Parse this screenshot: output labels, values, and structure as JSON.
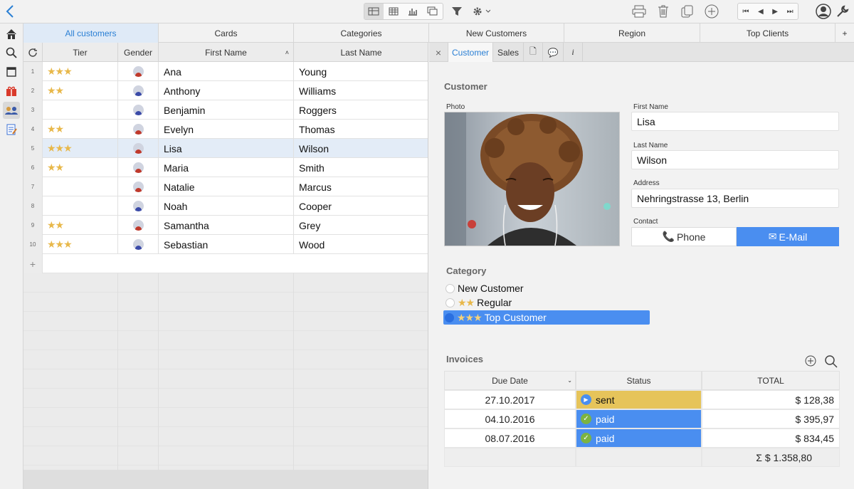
{
  "toolbar": {
    "back": "back",
    "views": [
      "form-view",
      "grid-view",
      "chart-view",
      "gallery-view"
    ],
    "filter": "filter",
    "settings": "settings",
    "actions": [
      "print",
      "delete",
      "duplicate",
      "add"
    ],
    "nav": [
      "first",
      "previous",
      "next",
      "last"
    ],
    "account": "account",
    "tools": "tools"
  },
  "sidebar": [
    {
      "name": "home-icon"
    },
    {
      "name": "search-icon"
    },
    {
      "name": "window-icon"
    },
    {
      "name": "gift-icon"
    },
    {
      "name": "customers-icon",
      "selected": true
    },
    {
      "name": "notes-icon"
    }
  ],
  "tabs": [
    "All customers",
    "Cards",
    "Categories",
    "New Customers",
    "Region",
    "Top Clients"
  ],
  "tabs_add": "+",
  "grid": {
    "headers": [
      "Tier",
      "Gender",
      "First Name",
      "Last Name"
    ],
    "sort_indicator": "˄",
    "rows": [
      {
        "n": "1",
        "stars": "★★★",
        "gender": "f",
        "first": "Ana",
        "last": "Young"
      },
      {
        "n": "2",
        "stars": "★★",
        "gender": "m",
        "first": "Anthony",
        "last": "Williams"
      },
      {
        "n": "3",
        "stars": "",
        "gender": "m",
        "first": "Benjamin",
        "last": "Roggers"
      },
      {
        "n": "4",
        "stars": "★★",
        "gender": "f",
        "first": "Evelyn",
        "last": "Thomas"
      },
      {
        "n": "5",
        "stars": "★★★",
        "gender": "f",
        "first": "Lisa",
        "last": "Wilson",
        "selected": true
      },
      {
        "n": "6",
        "stars": "★★",
        "gender": "f",
        "first": "Maria",
        "last": "Smith"
      },
      {
        "n": "7",
        "stars": "",
        "gender": "f",
        "first": "Natalie",
        "last": "Marcus"
      },
      {
        "n": "8",
        "stars": "",
        "gender": "m",
        "first": "Noah",
        "last": "Cooper"
      },
      {
        "n": "9",
        "stars": "★★",
        "gender": "f",
        "first": "Samantha",
        "last": "Grey"
      },
      {
        "n": "10",
        "stars": "★★★",
        "gender": "m",
        "first": "Sebastian",
        "last": "Wood"
      }
    ],
    "add_row": "+"
  },
  "detail": {
    "tabs": [
      "×",
      "Customer",
      "Sales",
      "🗋",
      "💬",
      "i"
    ],
    "section_title": "Customer",
    "photo_label": "Photo",
    "first_name_label": "First Name",
    "first_name": "Lisa",
    "last_name_label": "Last Name",
    "last_name": "Wilson",
    "address_label": "Address",
    "address": "Nehringstrasse 13, Berlin",
    "contact_label": "Contact",
    "contact_phone": "Phone",
    "contact_email": "E-Mail",
    "category_title": "Category",
    "categories": [
      {
        "label": "New Customer",
        "stars": ""
      },
      {
        "label": "Regular",
        "stars": "★★"
      },
      {
        "label": "Top Customer",
        "stars": "★★★",
        "selected": true
      }
    ],
    "invoices_title": "Invoices",
    "invoice_headers": [
      "Due Date",
      "Status",
      "TOTAL"
    ],
    "invoices": [
      {
        "date": "27.10.2017",
        "status": "sent",
        "total": "$ 128,38"
      },
      {
        "date": "04.10.2016",
        "status": "paid",
        "total": "$ 395,97"
      },
      {
        "date": "08.07.2016",
        "status": "paid",
        "total": "$ 834,45"
      }
    ],
    "invoice_sum": "Σ $ 1.358,80"
  },
  "colors": {
    "accent": "#2a7fd4",
    "selected_blue": "#4a8ef0",
    "sent_yellow": "#e6c45a",
    "paid_blue": "#4a8ef0",
    "star": "#e8b84a"
  }
}
